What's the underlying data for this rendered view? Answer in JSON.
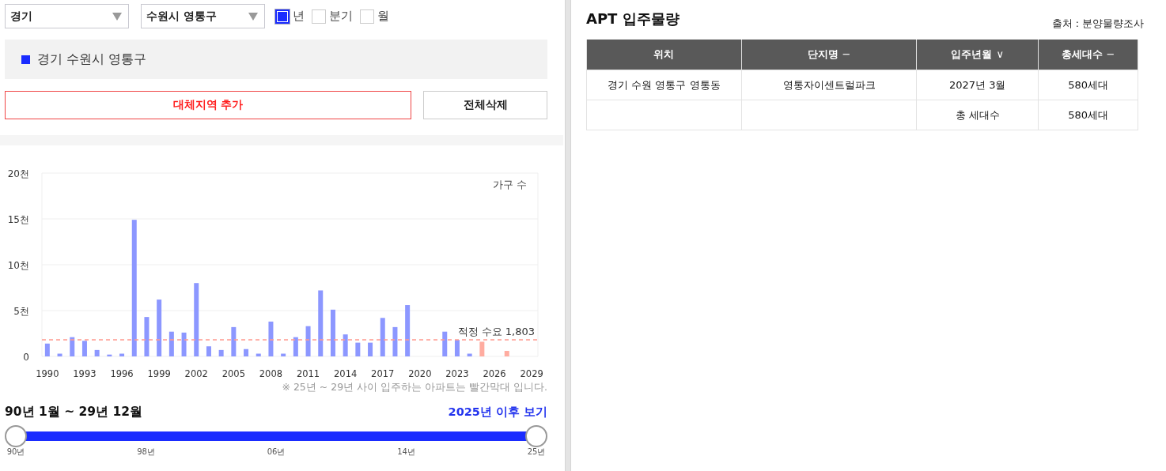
{
  "filters": {
    "selects": [
      {
        "value": "경기"
      },
      {
        "value": "수원시 영통구"
      }
    ],
    "periods": [
      {
        "label": "년",
        "checked": true
      },
      {
        "label": "분기",
        "checked": false
      },
      {
        "label": "월",
        "checked": false
      }
    ]
  },
  "regions": [
    {
      "label": "경기 수원시 영통구",
      "color": "#1a2cff"
    }
  ],
  "buttons": [
    {
      "label": "대체지역 추가",
      "kind": "primary"
    },
    {
      "label": "전체삭제",
      "kind": "plain"
    }
  ],
  "chart": {
    "chart_data": {
      "type": "bar",
      "ylabel": "가구 수",
      "x": [
        1990,
        1991,
        1992,
        1993,
        1994,
        1995,
        1996,
        1997,
        1998,
        1999,
        2000,
        2001,
        2002,
        2003,
        2004,
        2005,
        2006,
        2007,
        2008,
        2009,
        2010,
        2011,
        2012,
        2013,
        2014,
        2015,
        2016,
        2017,
        2018,
        2019,
        2020,
        2021,
        2022,
        2023,
        2024,
        2025,
        2026,
        2027,
        2028,
        2029
      ],
      "series": [
        {
          "color": "#8c97ff",
          "values": [
            1.4,
            0.3,
            2.1,
            1.7,
            0.7,
            0.2,
            0.3,
            14.9,
            4.3,
            6.2,
            2.7,
            2.6,
            8.0,
            1.1,
            0.7,
            3.2,
            0.8,
            0.3,
            3.8,
            0.3,
            2.1,
            3.3,
            7.2,
            5.1,
            2.4,
            1.5,
            1.5,
            4.2,
            3.2,
            5.6,
            0,
            0,
            2.7,
            1.8,
            0.3,
            null,
            null,
            null,
            null,
            null
          ]
        },
        {
          "color": "#ffaca0",
          "values": [
            null,
            null,
            null,
            null,
            null,
            null,
            null,
            null,
            null,
            null,
            null,
            null,
            null,
            null,
            null,
            null,
            null,
            null,
            null,
            null,
            null,
            null,
            null,
            null,
            null,
            null,
            null,
            null,
            null,
            null,
            null,
            null,
            null,
            null,
            null,
            1.6,
            0,
            0.6,
            0,
            0
          ]
        }
      ],
      "xlim": [
        1989.5,
        2029.5
      ],
      "ylim": [
        0,
        20
      ],
      "xticks": [
        1990,
        1993,
        1996,
        1999,
        2002,
        2005,
        2008,
        2011,
        2014,
        2017,
        2020,
        2023,
        2026,
        2029
      ],
      "yticks": [
        {
          "value": 0,
          "label": "0"
        },
        {
          "value": 5,
          "label": "5천"
        },
        {
          "value": 10,
          "label": "10천"
        },
        {
          "value": 15,
          "label": "15천"
        },
        {
          "value": 20,
          "label": "20천"
        }
      ],
      "grid": true,
      "ref_lines": [
        {
          "axis": "y",
          "value": 1.803,
          "label": "적정 수요 1,803"
        }
      ]
    }
  },
  "note": "※ 25년 ~ 29년 사이 입주하는 아파트는 빨간막대 입니다.",
  "range": {
    "label": "90년 1월 ~ 29년 12월",
    "link": "2025년 이후 보기",
    "thumbs": [
      {
        "level": 0
      },
      {
        "level": 1
      }
    ],
    "ticks": [
      "90년",
      "98년",
      "06년",
      "14년",
      "25년"
    ]
  },
  "supply": {
    "title": "APT 입주물량",
    "source": "출처 : 분양물량조사",
    "columns": [
      {
        "label": "위치"
      },
      {
        "label": "단지명",
        "sort": "−"
      },
      {
        "label": "입주년월",
        "sort": "∨"
      },
      {
        "label": "총세대수",
        "sort": "−"
      }
    ],
    "rows": [
      [
        "경기 수원 영통구 영통동",
        "영통자이센트럴파크",
        "2027년 3월",
        "580세대"
      ],
      [
        null,
        null,
        "총 세대수",
        "580세대"
      ]
    ]
  }
}
